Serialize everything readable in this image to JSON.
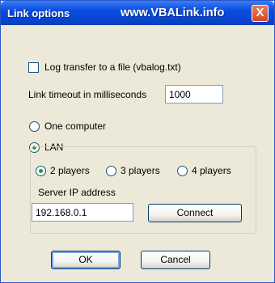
{
  "window": {
    "title": "Link options",
    "url": "www.VBALink.info",
    "close_glyph": "X"
  },
  "options": {
    "log_transfer_label": "Log transfer to a file (vbalog.txt)",
    "log_transfer_checked": false,
    "timeout_label": "Link timeout in milliseconds",
    "timeout_value": "1000"
  },
  "mode": {
    "one_computer_label": "One computer",
    "lan_label": "LAN",
    "selected": "LAN"
  },
  "lan": {
    "players": [
      "2 players",
      "3 players",
      "4 players"
    ],
    "selected_players": "2 players",
    "server_ip_label": "Server IP address",
    "server_ip_value": "192.168.0.1",
    "connect_label": "Connect"
  },
  "footer": {
    "ok_label": "OK",
    "cancel_label": "Cancel"
  },
  "colors": {
    "titlebar": "#0a4de0",
    "close_button": "#d64a22",
    "dialog_background": "#ece9d8",
    "radio_selected": "#21a121"
  }
}
